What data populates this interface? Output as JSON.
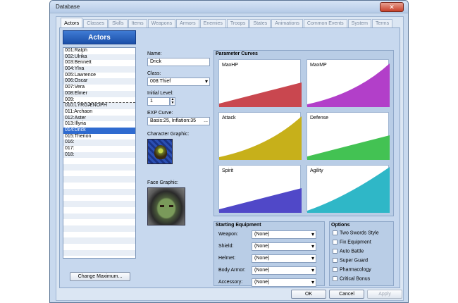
{
  "window": {
    "title": "Database",
    "close_label": "✕"
  },
  "tabs": [
    "Actors",
    "Classes",
    "Skills",
    "Items",
    "Weapons",
    "Armors",
    "Enemies",
    "Troops",
    "States",
    "Animations",
    "Common Events",
    "System",
    "Terms"
  ],
  "actors": {
    "header": "Actors",
    "items": [
      "001:Ralph",
      "002:Ulrika",
      "003:Bennett",
      "004:Ylva",
      "005:Lawrence",
      "006:Oscar",
      "007:Vera",
      "008:Elmer",
      "009:",
      "010:LÝRGÆNOPH",
      "011:Archaon",
      "012:Aster",
      "013:Illyria",
      "014:Drick",
      "015:Therion",
      "016:",
      "017:",
      "018:"
    ],
    "selected_index": 13,
    "change_max_label": "Change Maximum..."
  },
  "form": {
    "name_label": "Name:",
    "name_value": "Drick",
    "class_label": "Class:",
    "class_value": "008:Thief",
    "initial_level_label": "Initial Level:",
    "initial_level_value": "1",
    "exp_curve_label": "EXP Curve:",
    "exp_curve_value": "Basis:25, Inflation:35",
    "exp_curve_btn": "...",
    "char_graphic_label": "Character Graphic:",
    "face_graphic_label": "Face Graphic:"
  },
  "curves": {
    "title": "Parameter Curves",
    "items": [
      {
        "label": "MaxHP",
        "color": "#c9474f",
        "shape": "linear"
      },
      {
        "label": "MaxMP",
        "color": "#b23fc9",
        "shape": "convex"
      },
      {
        "label": "Attack",
        "color": "#c7b01a",
        "shape": "convex"
      },
      {
        "label": "Defense",
        "color": "#43c253",
        "shape": "linear"
      },
      {
        "label": "Spirit",
        "color": "#5048c8",
        "shape": "linear"
      },
      {
        "label": "Agility",
        "color": "#2fb7c7",
        "shape": "steep"
      }
    ]
  },
  "equipment": {
    "title": "Starting Equipment",
    "rows": [
      {
        "label": "Weapon:",
        "value": "(None)"
      },
      {
        "label": "Shield:",
        "value": "(None)"
      },
      {
        "label": "Helmet:",
        "value": "(None)"
      },
      {
        "label": "Body Armor:",
        "value": "(None)"
      },
      {
        "label": "Accessory:",
        "value": "(None)"
      }
    ]
  },
  "options": {
    "title": "Options",
    "items": [
      "Two Swords Style",
      "Fix Equipment",
      "Auto Battle",
      "Super Guard",
      "Pharmacology",
      "Critical Bonus"
    ]
  },
  "buttons": {
    "ok": "OK",
    "cancel": "Cancel",
    "apply": "Apply"
  }
}
